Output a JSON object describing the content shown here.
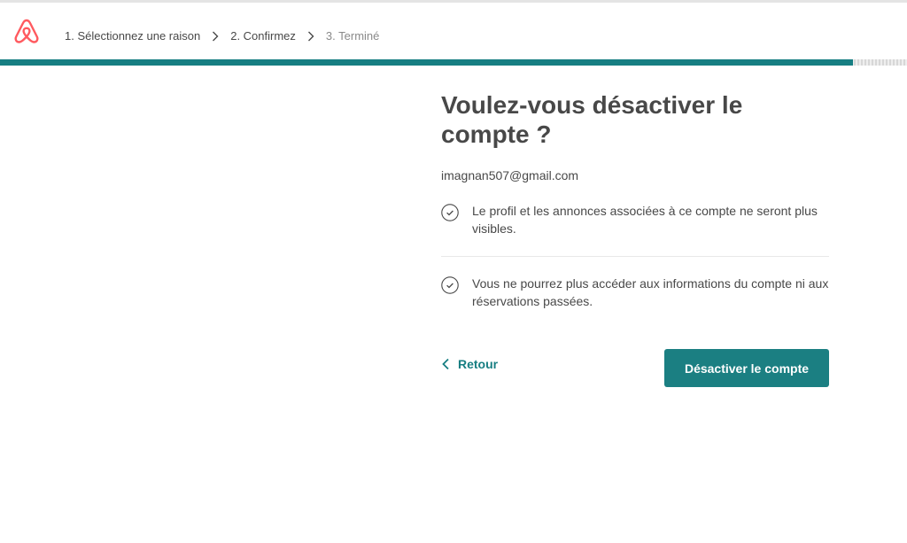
{
  "header": {
    "steps": [
      {
        "label": "1. Sélectionnez une raison",
        "state": "done"
      },
      {
        "label": "2. Confirmez",
        "state": "current"
      },
      {
        "label": "3. Terminé",
        "state": "upcoming"
      }
    ]
  },
  "progress": {
    "value": 0.94
  },
  "main": {
    "title": "Voulez-vous désactiver le compte ?",
    "email": "imagnan507@gmail.com",
    "items": [
      {
        "text": "Le profil et les annonces associées à ce compte ne seront plus visibles."
      },
      {
        "text": "Vous ne pourrez plus accéder aux informations du compte ni aux réservations passées."
      }
    ],
    "back_label": "Retour",
    "deactivate_label": "Désactiver le compte"
  },
  "colors": {
    "brand": "#ff5a5f",
    "accent": "#177e82",
    "text": "#484848"
  },
  "icons": {
    "logo": "airbnb-logo-icon",
    "separator": "chevron-right-icon",
    "check": "check-circle-icon",
    "back": "chevron-left-icon"
  }
}
